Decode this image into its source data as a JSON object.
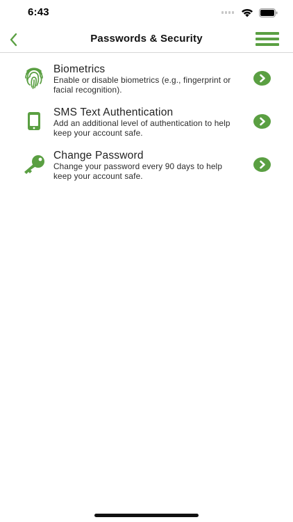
{
  "status_bar": {
    "time": "6:43"
  },
  "nav": {
    "title": "Passwords & Security"
  },
  "accent_color": "#5a9f42",
  "items": [
    {
      "title": "Biometrics",
      "description": "Enable or disable biometrics (e.g., fingerprint or facial recognition).",
      "icon": "fingerprint-icon"
    },
    {
      "title": "SMS Text Authentication",
      "description": "Add an additional level of authentication to help keep your account safe.",
      "icon": "phone-icon"
    },
    {
      "title": "Change Password",
      "description": "Change your password every 90 days to help keep your account safe.",
      "icon": "key-icon"
    }
  ]
}
